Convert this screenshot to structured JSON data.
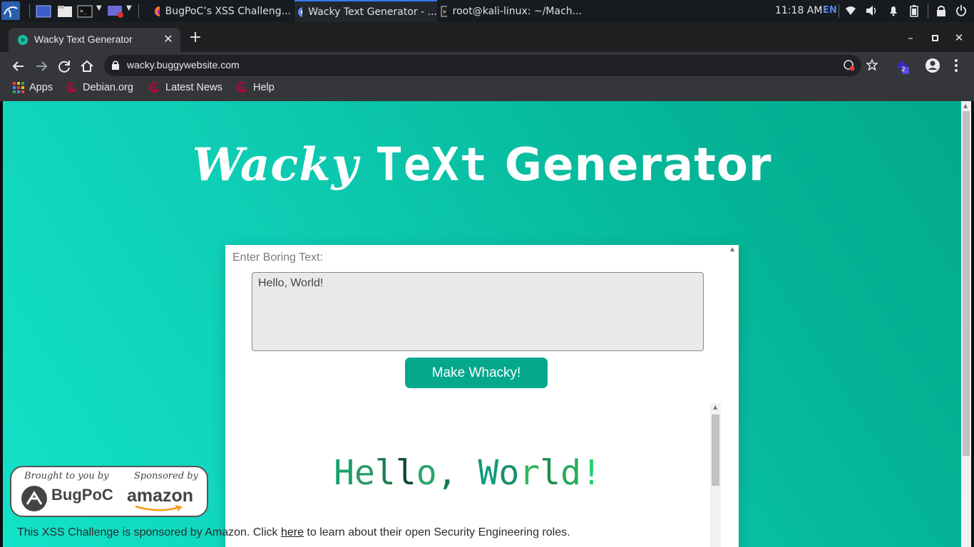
{
  "os_taskbar": {
    "tasks": [
      {
        "label": "BugPoC’s XSS Challeng...",
        "icon": "firefox-icon"
      },
      {
        "label": "Wacky Text Generator - ...",
        "icon": "chrome-icon"
      },
      {
        "label": "root@kali-linux: ~/Mach...",
        "icon": "terminal-icon"
      }
    ],
    "clock": "11:18 AM",
    "language": "EN"
  },
  "browser": {
    "tab_title": "Wacky Text Generator",
    "url": "wacky.buggywebsite.com",
    "extension_badge": "2",
    "bookmarks": [
      "Apps",
      "Debian.org",
      "Latest News",
      "Help"
    ]
  },
  "page": {
    "title_words": [
      "Wacky",
      "TeXt",
      "Generator"
    ],
    "input_label": "Enter Boring Text:",
    "input_value": "Hello, World!",
    "button_label": "Make Whacky!",
    "output_chars": [
      {
        "ch": "H",
        "color": "#1aa06a"
      },
      {
        "ch": "e",
        "color": "#2b9a63"
      },
      {
        "ch": "l",
        "color": "#1d7c4e"
      },
      {
        "ch": "l",
        "color": "#0a4a2a"
      },
      {
        "ch": "o",
        "color": "#2aa56c"
      },
      {
        "ch": ",",
        "color": "#157a4a"
      },
      {
        "ch": " ",
        "color": "#000000"
      },
      {
        "ch": "W",
        "color": "#0e9b7c"
      },
      {
        "ch": "o",
        "color": "#1a8e6a"
      },
      {
        "ch": "r",
        "color": "#34b85a"
      },
      {
        "ch": "l",
        "color": "#1c8e4e"
      },
      {
        "ch": "d",
        "color": "#2aaa5a"
      },
      {
        "ch": "!",
        "color": "#1ed06a"
      }
    ],
    "footer_before": "This XSS Challenge is sponsored by Amazon. Click ",
    "footer_link": "here",
    "footer_after": " to learn about their open Security Engineering roles.",
    "sponsor": {
      "brought_label": "Brought to you by",
      "brought_logo": "BugPoC",
      "sponsored_label": "Sponsored by",
      "sponsored_logo": "amazon"
    }
  },
  "colors": {
    "accent": "#05a88c",
    "gradient_light": "#12e2c9",
    "gradient_dark": "#03a98c"
  }
}
